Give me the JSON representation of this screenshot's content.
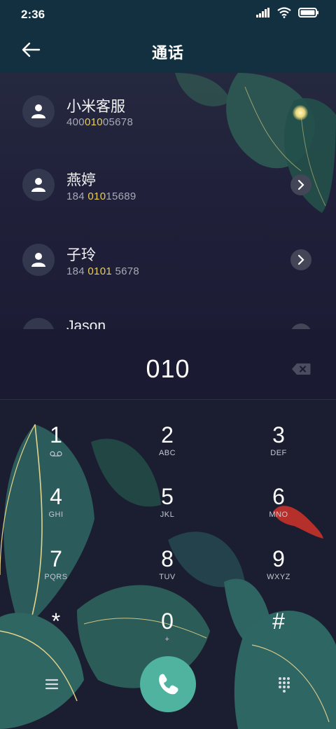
{
  "status": {
    "time": "2:36"
  },
  "header": {
    "title": "通话"
  },
  "contacts": [
    {
      "name": "小米客服",
      "number_pre": "400",
      "number_hl": "010",
      "number_post": "05678"
    },
    {
      "name": "燕婷",
      "number_pre": "184 ",
      "number_hl": "010",
      "number_post": "15689"
    },
    {
      "name": "子玲",
      "number_pre": "184 ",
      "number_hl": "0101",
      "number_post": " 5678"
    },
    {
      "name": "Jason"
    }
  ],
  "display": {
    "digits": "010"
  },
  "keypad": [
    {
      "digit": "1",
      "letters": ""
    },
    {
      "digit": "2",
      "letters": "ABC"
    },
    {
      "digit": "3",
      "letters": "DEF"
    },
    {
      "digit": "4",
      "letters": "GHI"
    },
    {
      "digit": "5",
      "letters": "JKL"
    },
    {
      "digit": "6",
      "letters": "MNO"
    },
    {
      "digit": "7",
      "letters": "PQRS"
    },
    {
      "digit": "8",
      "letters": "TUV"
    },
    {
      "digit": "9",
      "letters": "WXYZ"
    },
    {
      "digit": "*",
      "letters": ""
    },
    {
      "digit": "0",
      "letters": "+"
    },
    {
      "digit": "#",
      "letters": ""
    }
  ],
  "icons": {
    "back": "arrow-left-icon",
    "chevron": "chevron-right-icon",
    "backspace": "backspace-icon",
    "call": "phone-icon",
    "menu": "menu-icon",
    "dialpad": "dialpad-icon"
  },
  "colors": {
    "header": "#12303f",
    "highlight": "#e7cf5b",
    "call": "#4fb3a0"
  }
}
